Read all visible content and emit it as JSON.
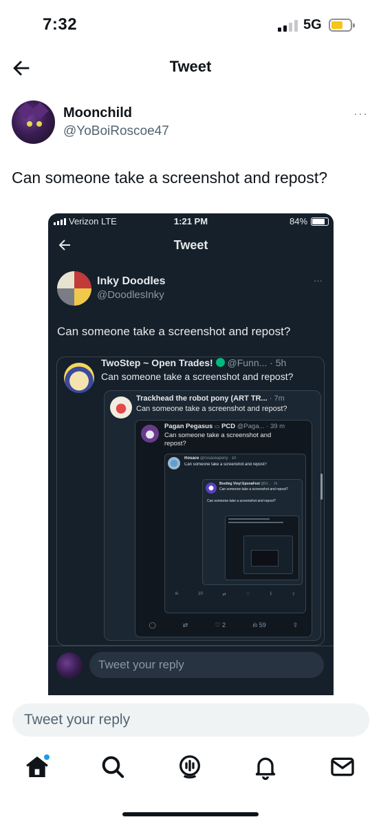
{
  "status_bar": {
    "time": "7:32",
    "network": "5G"
  },
  "header": {
    "title": "Tweet"
  },
  "author": {
    "name": "Moonchild",
    "handle": "@YoBoiRoscoe47",
    "more": "···"
  },
  "tweet": {
    "text": "Can someone take a screenshot and repost?"
  },
  "screenshot": {
    "status": {
      "carrier": "Verizon  LTE",
      "time": "1:21 PM",
      "battery": "84%"
    },
    "header_title": "Tweet",
    "author": {
      "name": "Inky Doodles",
      "handle": "@DoodlesInky",
      "more": "···"
    },
    "text": "Can someone take a screenshot and repost?",
    "quote1": {
      "name": "TwoStep ~ Open Trades!",
      "meta": "@Funn... · 5h",
      "text": "Can someone take a screenshot and repost?"
    },
    "quote2": {
      "name": "Trackhead the robot pony (ART TR...",
      "meta": "· 7m",
      "text": "Can someone take a screenshot and repost?"
    },
    "quote3": {
      "name": "Pagan Pegasus",
      "flag": "PCD",
      "meta": "@Paga... · 39 m",
      "text": "Can someone take a screenshot and repost?"
    },
    "quote4": {
      "name": "Rosace",
      "meta": "@rosaceapony · 1h",
      "text": "Can someone take a screenshot and repost?"
    },
    "quote5": {
      "name": "Bootleg Vinyl",
      "extra": "EponaFest",
      "meta": "@Dr... · 1h",
      "text": "Can someone take a screenshot and repost?"
    },
    "quote5_caption": "Can someone take a screenshot and repost?",
    "actions3": {
      "reply": "",
      "retweet": "",
      "like": "2",
      "views": "59"
    },
    "actions4": {
      "views": "10",
      "likes": "1",
      "views2": "56"
    },
    "reply_placeholder": "Tweet your reply"
  },
  "reply": {
    "placeholder": "Tweet your reply"
  },
  "nav": {
    "items": [
      "home-icon",
      "search-icon",
      "spaces-icon",
      "notifications-icon",
      "messages-icon"
    ]
  }
}
